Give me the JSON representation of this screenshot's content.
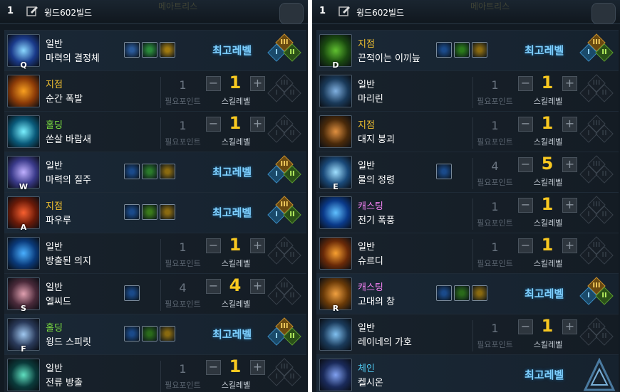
{
  "left": {
    "number": "1",
    "build_name": "윙드602빌드",
    "ghost_text": "메아트리스",
    "skills": [
      {
        "type": "일반",
        "type_color": "normal",
        "name": "마력의 결정체",
        "key": "Q",
        "maxed": true,
        "selected": true,
        "icon_color": "#1a3a8a",
        "icon_accent": "#8ad8ff",
        "specs": [
          "#2a5a9a",
          "#2a8a3a",
          "#a07a10"
        ]
      },
      {
        "type": "지점",
        "type_color": "gold",
        "name": "순간 폭발",
        "key": "",
        "maxed": false,
        "req": "1",
        "level": "1",
        "icon_color": "#8a3a08",
        "icon_accent": "#f8a020"
      },
      {
        "type": "홀딩",
        "type_color": "green",
        "name": "쏜살 바람새",
        "key": "",
        "maxed": false,
        "req": "1",
        "level": "1",
        "icon_color": "#0a5a7a",
        "icon_accent": "#7af0ff"
      },
      {
        "type": "일반",
        "type_color": "normal",
        "name": "마력의 질주",
        "key": "W",
        "maxed": true,
        "specs": [
          "#1a4a8a",
          "#2a7a2a",
          "#8a6a10"
        ],
        "icon_color": "#3a3a8a",
        "icon_accent": "#c0b0ff"
      },
      {
        "type": "지점",
        "type_color": "gold",
        "name": "파우루",
        "key": "A",
        "maxed": true,
        "specs": [
          "#1a4a8a",
          "#3a7a1a",
          "#8a6a10"
        ],
        "icon_color": "#6a1a08",
        "icon_accent": "#f86030"
      },
      {
        "type": "일반",
        "type_color": "normal",
        "name": "방출된 의지",
        "key": "",
        "maxed": false,
        "req": "1",
        "level": "1",
        "icon_color": "#0a3a7a",
        "icon_accent": "#4ab0ff"
      },
      {
        "type": "일반",
        "type_color": "normal",
        "name": "엘씨드",
        "key": "S",
        "maxed": false,
        "req": "4",
        "level": "4",
        "specs": [
          "#1a4a8a"
        ],
        "icon_color": "#4a2a3a",
        "icon_accent": "#e0a0b0"
      },
      {
        "type": "홀딩",
        "type_color": "green",
        "name": "윙드 스피릿",
        "key": "F",
        "maxed": true,
        "specs": [
          "#1a4a8a",
          "#2a6a1a",
          "#8a6a10"
        ],
        "icon_color": "#2a3a5a",
        "icon_accent": "#a0c8f0"
      },
      {
        "type": "일반",
        "type_color": "normal",
        "name": "전류 방출",
        "key": "",
        "maxed": false,
        "req": "1",
        "level": "1",
        "icon_color": "#0a3a3a",
        "icon_accent": "#60e0c0"
      }
    ]
  },
  "right": {
    "number": "1",
    "build_name": "윙드602빌드",
    "ghost_text": "메아트리스",
    "skills": [
      {
        "type": "지점",
        "type_color": "gold",
        "name": "끈적이는 이끼늪",
        "key": "D",
        "maxed": true,
        "specs": [
          "#1a4a8a",
          "#2a7a1a",
          "#8a6a10"
        ],
        "icon_color": "#1a4a10",
        "icon_accent": "#60c030"
      },
      {
        "type": "일반",
        "type_color": "normal",
        "name": "마리린",
        "key": "",
        "maxed": false,
        "req": "1",
        "level": "1",
        "icon_color": "#1a3a5a",
        "icon_accent": "#80b0e0"
      },
      {
        "type": "지점",
        "type_color": "gold",
        "name": "대지 붕괴",
        "key": "",
        "maxed": false,
        "req": "1",
        "level": "1",
        "icon_color": "#4a2a0a",
        "icon_accent": "#e09040"
      },
      {
        "type": "일반",
        "type_color": "normal",
        "name": "물의 정령",
        "key": "E",
        "maxed": false,
        "req": "4",
        "level": "5",
        "specs": [
          "#1a4a8a"
        ],
        "icon_color": "#1a4a7a",
        "icon_accent": "#a0e0ff"
      },
      {
        "type": "캐스팅",
        "type_color": "pink",
        "name": "전기 폭풍",
        "key": "",
        "maxed": false,
        "req": "1",
        "level": "1",
        "icon_color": "#0a3a8a",
        "icon_accent": "#60c0ff"
      },
      {
        "type": "일반",
        "type_color": "normal",
        "name": "슈르디",
        "key": "",
        "maxed": false,
        "req": "1",
        "level": "1",
        "icon_color": "#6a2a08",
        "icon_accent": "#f8a030"
      },
      {
        "type": "캐스팅",
        "type_color": "pink",
        "name": "고대의 창",
        "key": "R",
        "maxed": true,
        "specs": [
          "#1a4a8a",
          "#2a6a1a",
          "#8a6a10"
        ],
        "icon_color": "#6a3a08",
        "icon_accent": "#f0a040"
      },
      {
        "type": "일반",
        "type_color": "normal",
        "name": "레이네의 가호",
        "key": "",
        "maxed": false,
        "req": "1",
        "level": "1",
        "icon_color": "#1a3a5a",
        "icon_accent": "#80c0f0"
      },
      {
        "type": "체인",
        "type_color": "cyan",
        "name": "켈시온",
        "key": "",
        "maxed": true,
        "chain": true,
        "icon_color": "#1a2a5a",
        "icon_accent": "#80a0f0"
      }
    ]
  },
  "labels": {
    "max": "최고레벨",
    "req": "필요포인트",
    "level": "스킬레벨",
    "minus": "−",
    "plus": "+",
    "tier3": "III",
    "tier1": "I",
    "tier2": "II"
  }
}
